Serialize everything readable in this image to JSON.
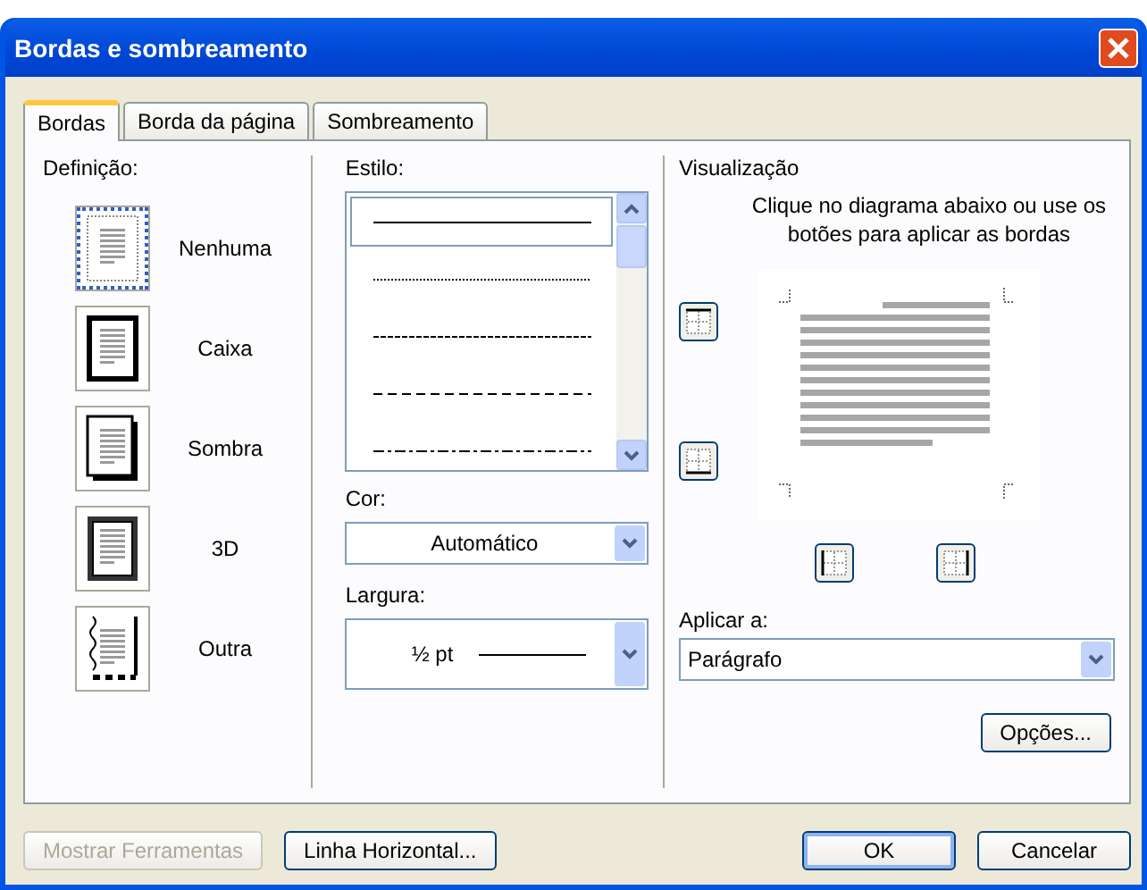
{
  "window": {
    "title": "Bordas e sombreamento"
  },
  "tabs": [
    {
      "label": "Bordas",
      "selected": true
    },
    {
      "label": "Borda da página",
      "selected": false
    },
    {
      "label": "Sombreamento",
      "selected": false
    }
  ],
  "setting": {
    "label": "Definição:",
    "options": [
      {
        "kind": "none",
        "label": "Nenhuma",
        "selected": true
      },
      {
        "kind": "box",
        "label": "Caixa",
        "selected": false
      },
      {
        "kind": "shadow",
        "label": "Sombra",
        "selected": false
      },
      {
        "kind": "threed",
        "label": "3D",
        "selected": false
      },
      {
        "kind": "custom",
        "label": "Outra",
        "selected": false
      }
    ]
  },
  "style": {
    "label": "Estilo:",
    "lines": [
      {
        "kind": "solid",
        "selected": true
      },
      {
        "kind": "dotted",
        "selected": false
      },
      {
        "kind": "dashed",
        "selected": false
      },
      {
        "kind": "long-dash",
        "selected": false
      },
      {
        "kind": "dash-dot",
        "selected": false
      }
    ]
  },
  "color": {
    "label": "Cor:",
    "value": "Automático"
  },
  "width": {
    "label": "Largura:",
    "value": "½ pt"
  },
  "preview": {
    "label": "Visualização",
    "hint": "Clique no diagrama abaixo ou use os botões para aplicar as bordas",
    "border_buttons": [
      {
        "kind": "top"
      },
      {
        "kind": "bottom"
      },
      {
        "kind": "left"
      },
      {
        "kind": "right"
      }
    ]
  },
  "apply_to": {
    "label": "Aplicar a:",
    "value": "Parágrafo"
  },
  "options_button": "Opções...",
  "buttons": [
    {
      "label": "Mostrar Ferramentas",
      "disabled": true,
      "default": false
    },
    {
      "label": "Linha Horizontal...",
      "disabled": false,
      "default": false
    },
    {
      "label": "OK",
      "disabled": false,
      "default": true
    },
    {
      "label": "Cancelar",
      "disabled": false,
      "default": false
    }
  ]
}
